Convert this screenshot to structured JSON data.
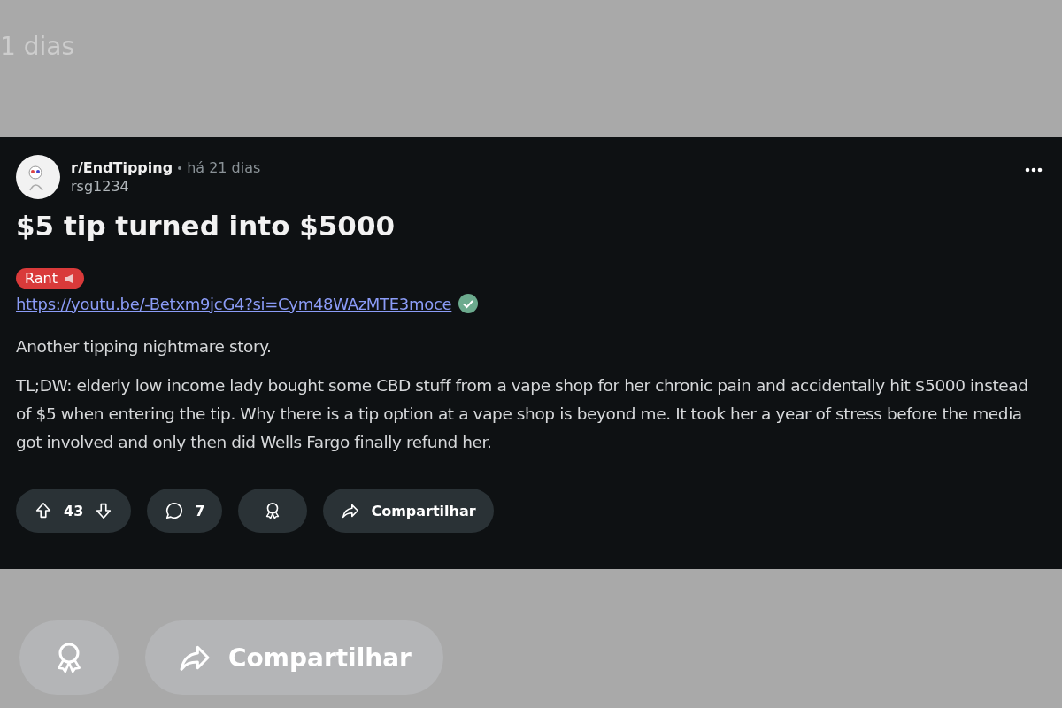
{
  "background": {
    "time_fragment": "1 dias",
    "actions": [
      {
        "kind": "award"
      },
      {
        "kind": "share",
        "label": "Compartilhar"
      }
    ]
  },
  "post": {
    "subreddit": "r/EndTipping",
    "time": "há 21 dias",
    "author": "rsg1234",
    "title": "$5 tip turned into $5000",
    "flair": "Rant",
    "link": "https://youtu.be/-Betxm9jcG4?si=Cym48WAzMTE3moce",
    "paragraphs": [
      "Another tipping nightmare story.",
      "TL;DW: elderly low income lady bought some CBD stuff from a vape shop for her chronic pain and accidentally hit $5000 instead of $5 when entering the tip. Why there is a tip option at a vape shop is beyond me. It took her a year of stress before the media got involved and only then did Wells Fargo finally refund her."
    ],
    "actions": [
      {
        "kind": "vote",
        "count": "43"
      },
      {
        "kind": "comments",
        "count": "7"
      },
      {
        "kind": "award"
      },
      {
        "kind": "share",
        "label": "Compartilhar"
      }
    ]
  }
}
